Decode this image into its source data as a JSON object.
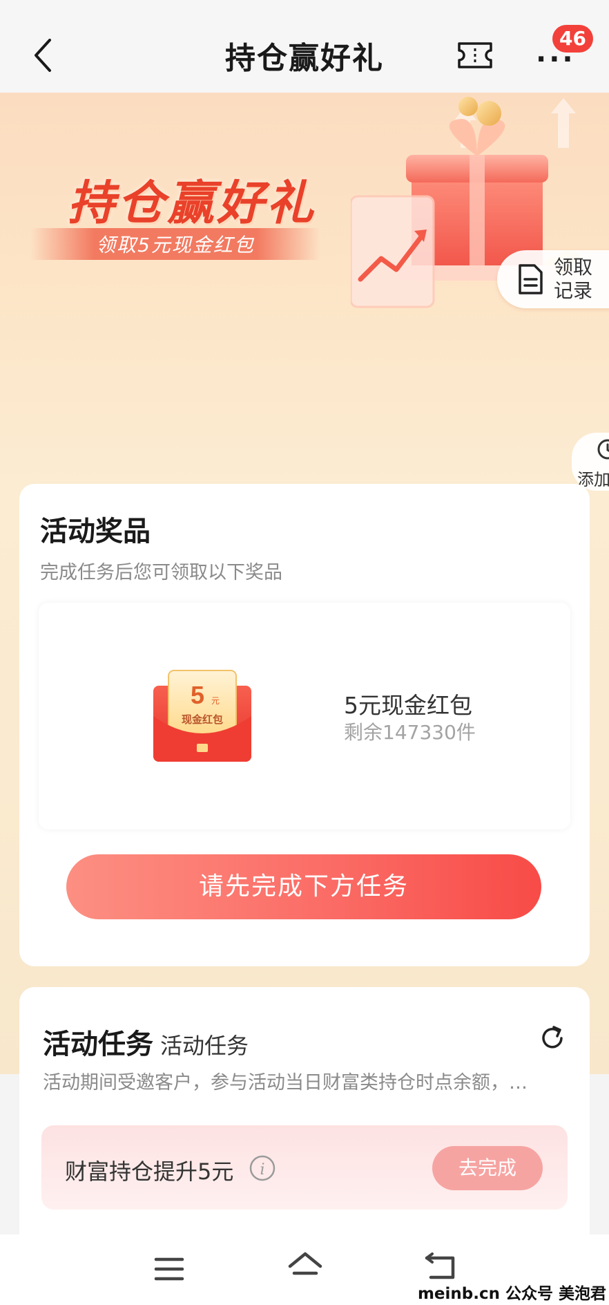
{
  "header": {
    "title": "持仓赢好礼",
    "notification_count": "46"
  },
  "hero": {
    "title": "持仓赢好礼",
    "subtitle": "领取5元现金红包",
    "record_label": "领取记录",
    "add_label": "添加"
  },
  "prize_card": {
    "title": "活动奖品",
    "description": "完成任务后您可领取以下奖品",
    "envelope_amount": "5",
    "envelope_unit": "元",
    "envelope_caption": "现金红包",
    "prize_name": "5元现金红包",
    "prize_remaining": "剩余147330件",
    "cta_label": "请先完成下方任务"
  },
  "task_card": {
    "title": "活动任务",
    "title_sub": "活动任务",
    "description": "活动期间受邀客户，参与活动当日财富类持仓时点余额，…",
    "tasks": [
      {
        "label": "财富持仓提升5元",
        "button": "去完成"
      }
    ]
  },
  "watermark": "meinb.cn  公众号 美泡君",
  "colors": {
    "accent_red": "#f84b47",
    "badge_red": "#f2413a",
    "hero_bg": "#fbe6c8",
    "task_button": "#f6a4a2"
  },
  "icons": [
    "back-arrow-icon",
    "ticket-icon",
    "more-icon",
    "document-icon",
    "clock-icon",
    "refresh-icon",
    "info-icon",
    "menu-icon",
    "home-icon",
    "back-icon"
  ]
}
